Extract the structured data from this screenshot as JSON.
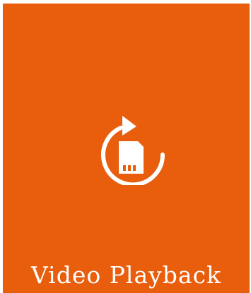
{
  "tile": {
    "label": "Video Playback",
    "background_color": "#e85e0d",
    "foreground_color": "#ffffff",
    "icon": "sd-card-refresh-icon"
  }
}
